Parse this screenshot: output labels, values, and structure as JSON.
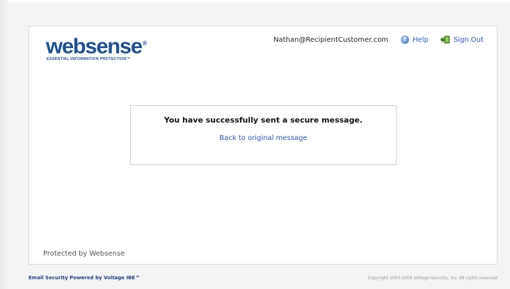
{
  "header": {
    "logo_prefix": "web",
    "logo_suffix": "sense",
    "logo_registered": "®",
    "tagline": "ESSENTIAL INFORMATION PROTECTION™",
    "user_email": "Nathan@RecipientCustomer.com",
    "help_label": "Help",
    "sign_out_label": "Sign Out",
    "help_icon": "help-icon",
    "sign_out_icon": "sign-out-icon"
  },
  "message": {
    "success_text": "You have successfully sent a secure message.",
    "back_link": "Back to original message"
  },
  "panel_footer": {
    "protected_by": "Protected by Websense"
  },
  "page_footer": {
    "powered_by": "Email Security Powered by Voltage IBE™",
    "copyright": "Copyright 2003-2009 Voltage Security, Inc. All rights reserved"
  },
  "colors": {
    "brand_blue": "#1f4f95",
    "link_blue": "#2a55b7",
    "border_gray": "#d8d8d8"
  }
}
